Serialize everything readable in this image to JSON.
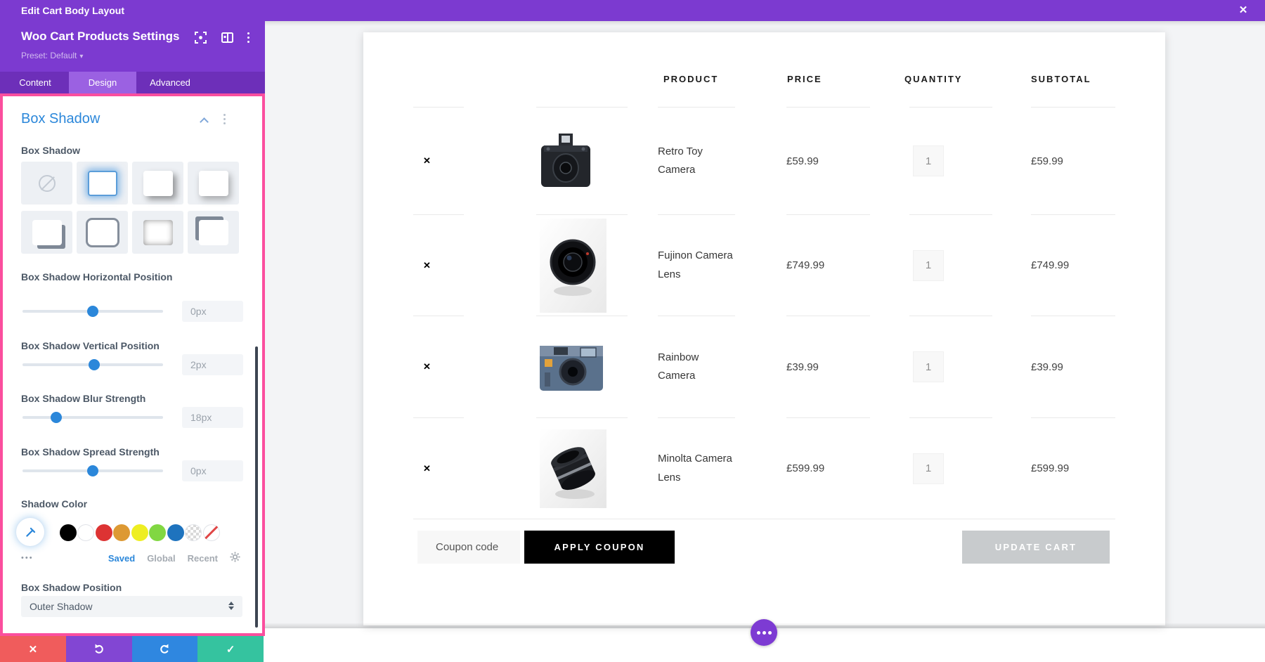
{
  "topbar": {
    "title": "Edit Cart Body Layout"
  },
  "icons": {
    "close": "✕",
    "remove": "✕",
    "check": "✓",
    "preset_caret": "▾",
    "more_dots": "•••"
  },
  "panel": {
    "title": "Woo Cart Products Settings",
    "preset_label": "Preset: Default",
    "tabs": [
      {
        "label": "Content",
        "active": false
      },
      {
        "label": "Design",
        "active": true
      },
      {
        "label": "Advanced",
        "active": false
      }
    ],
    "box_shadow": {
      "section_title": "Box Shadow",
      "field_label": "Box Shadow",
      "sliders": [
        {
          "label": "Box Shadow Horizontal Position",
          "value": "0px",
          "percent": "50%"
        },
        {
          "label": "Box Shadow Vertical Position",
          "value": "2px",
          "percent": "51%"
        },
        {
          "label": "Box Shadow Blur Strength",
          "value": "18px",
          "percent": "24%"
        },
        {
          "label": "Box Shadow Spread Strength",
          "value": "0px",
          "percent": "50%"
        }
      ],
      "shadow_color_label": "Shadow Color",
      "palette": [
        "#000000",
        "#ffffff",
        "#dd3333",
        "#dd9933",
        "#eeee22",
        "#81d742",
        "#1e73be"
      ],
      "palette_tabs": [
        {
          "label": "Saved",
          "active": true
        },
        {
          "label": "Global",
          "active": false
        },
        {
          "label": "Recent",
          "active": false
        }
      ],
      "position_label": "Box Shadow Position",
      "position_value": "Outer Shadow"
    }
  },
  "colors": {
    "accent_blue": "#2b87da",
    "builder_purple": "#7c3ad0",
    "highlight_pink": "#fb4e9e",
    "btn_red": "#f05c5c",
    "btn_purple": "#8246d3",
    "btn_blue": "#2f87e0",
    "btn_green": "#35c39f"
  },
  "cart": {
    "headers": [
      "PRODUCT",
      "PRICE",
      "QUANTITY",
      "SUBTOTAL"
    ],
    "rows": [
      {
        "name_line1": "Retro Toy",
        "name_line2": "Camera",
        "price": "£59.99",
        "qty": "1",
        "subtotal": "£59.99",
        "image": "retro-toy-camera-photo"
      },
      {
        "name_line1": "Fujinon Camera",
        "name_line2": "Lens",
        "price": "£749.99",
        "qty": "1",
        "subtotal": "£749.99",
        "image": "fujinon-camera-lens-photo"
      },
      {
        "name_line1": "Rainbow",
        "name_line2": "Camera",
        "price": "£39.99",
        "qty": "1",
        "subtotal": "£39.99",
        "image": "rainbow-camera-photo"
      },
      {
        "name_line1": "Minolta Camera",
        "name_line2": "Lens",
        "price": "£599.99",
        "qty": "1",
        "subtotal": "£599.99",
        "image": "minolta-camera-lens-photo"
      }
    ],
    "coupon_placeholder": "Coupon code",
    "apply_coupon_label": "APPLY COUPON",
    "update_cart_label": "UPDATE CART"
  }
}
